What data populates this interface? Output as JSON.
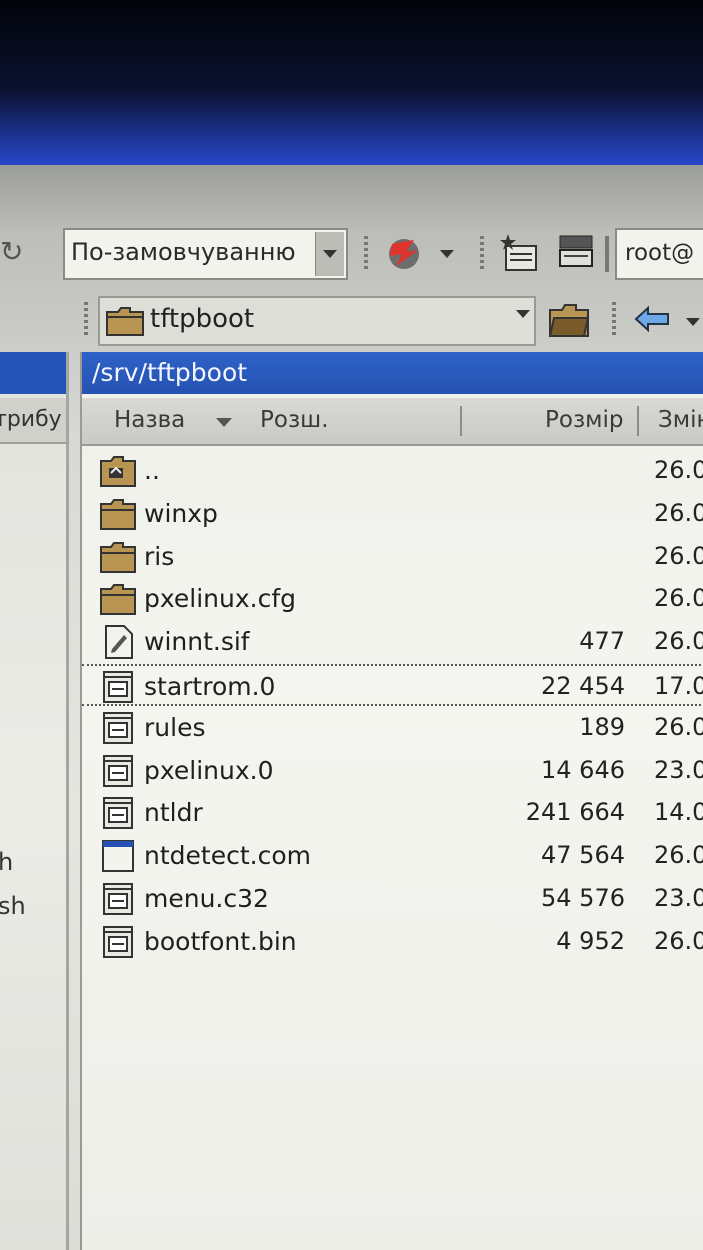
{
  "toolbar": {
    "view_mode": "По-замовчуванню",
    "connection": "root@"
  },
  "path_bar": {
    "current_folder": "tftpboot"
  },
  "left_panel": {
    "header_fragment": "трибу",
    "visible_items": [
      "h",
      "sh"
    ]
  },
  "right_panel": {
    "path": "/srv/tftpboot",
    "columns": {
      "name": "Назва",
      "ext": "Розш.",
      "size": "Розмір",
      "modified": "Змін"
    },
    "files": [
      {
        "name": "..",
        "size": "",
        "date": "26.0",
        "type": "parent-folder"
      },
      {
        "name": "winxp",
        "size": "",
        "date": "26.0",
        "type": "folder"
      },
      {
        "name": "ris",
        "size": "",
        "date": "26.0",
        "type": "folder"
      },
      {
        "name": "pxelinux.cfg",
        "size": "",
        "date": "26.0",
        "type": "folder"
      },
      {
        "name": "winnt.sif",
        "size": "477",
        "date": "26.0",
        "type": "text-file"
      },
      {
        "name": "startrom.0",
        "size": "22 454",
        "date": "17.0",
        "type": "binary-file"
      },
      {
        "name": "rules",
        "size": "189",
        "date": "26.0",
        "type": "binary-file"
      },
      {
        "name": "pxelinux.0",
        "size": "14 646",
        "date": "23.0",
        "type": "binary-file"
      },
      {
        "name": "ntldr",
        "size": "241 664",
        "date": "14.0",
        "type": "binary-file"
      },
      {
        "name": "ntdetect.com",
        "size": "47 564",
        "date": "26.0",
        "type": "executable-file"
      },
      {
        "name": "menu.c32",
        "size": "54 576",
        "date": "23.0",
        "type": "binary-file"
      },
      {
        "name": "bootfont.bin",
        "size": "4 952",
        "date": "26.0",
        "type": "binary-file"
      }
    ]
  },
  "colors": {
    "selection_blue": "#2552b2",
    "folder_tan": "#b89552",
    "panel_background": "#f0f0eb"
  }
}
